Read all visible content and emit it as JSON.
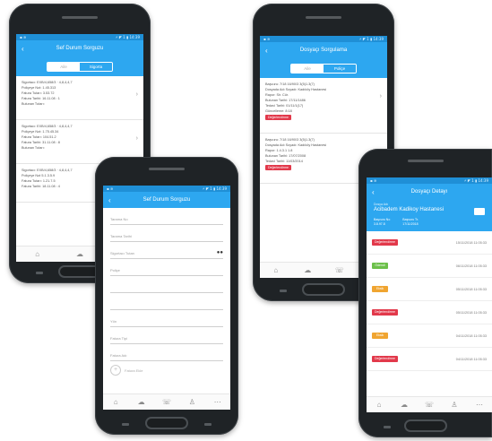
{
  "colors": {
    "primary": "#2da7f0",
    "status_dark": "#1f8fd6",
    "red": "#e2394b",
    "green": "#6cc04a",
    "orange": "#f0a531"
  },
  "phone1": {
    "status_left": "▪ ≋",
    "status_right": "⚡ ◤ 1 ▮ 14:39",
    "title": "Sef Durum Sorguzu",
    "tabs": [
      "Aile",
      "Sigorta"
    ],
    "cards": [
      {
        "lines": [
          "Sigortacı: EXB/4,658/3 · 4,8,4,4,7",
          "Poliçeye Not: 1.45.313",
          "Fatura Tutarı: 3.53.72",
          "Fatura Tarihi: 16.11.08 : 1",
          "Bulunan Tutarı:"
        ]
      },
      {
        "lines": [
          "Sigortacı: EXB/4,658/3 · 4,8,4,4,7",
          "Poliçeye Not: 1.75.45.34",
          "Fatura Tutarı: 104.51.2",
          "Fatura Tarihi: 31.11.08 : 8",
          "Bulunan Tutarı:"
        ]
      },
      {
        "lines": [
          "Sigortacı: EXB/4,658/3 · 4,8,4,4,7",
          "Poliçeye Not 5.1.3.5.9",
          "Fatura Tutarı: 1.21.7.5",
          "Fatura Tarihi: 18.11.08 : 4"
        ]
      }
    ],
    "tabbar": [
      "⌂",
      "☁",
      "☏"
    ]
  },
  "phone2": {
    "status_left": "▪ ≋",
    "status_right": "⚡ ◤ 1 ▮ 14:39",
    "title": "Sef Durum Sorguzu",
    "fields": [
      "Tarama No",
      "Tarama Tarihi",
      "Sigortacı Tutarı",
      "Poliçe",
      "",
      "",
      "Yön",
      "Fatura Tipi",
      "Fatura Adı"
    ],
    "eye": "●●",
    "fab_label": "Fatura Ekle",
    "tabbar": [
      "⌂",
      "☁",
      "☏",
      "♙",
      "⋯"
    ]
  },
  "phone3": {
    "status_left": "▪ ≋",
    "status_right": "⚡ ◤ 1 ▮ 14:39",
    "title": "Dosyaçı Sorgulama",
    "tabs": [
      "Aile",
      "Poliçe"
    ],
    "cards": [
      {
        "lines": [
          "Başvuru: 7/18 16/90/3 3(5)1.3(7)",
          "Dosyada Adı Soyadı: Kadıköy Hastanesi",
          "Rapor: Sir. Cür.",
          "Bulunan Tarihi: 17/11/1486",
          "Tedavi Tarihi: 01/11/1(17)",
          "Güncelleme: 8:18"
        ],
        "badge": "Değerlendirme"
      },
      {
        "lines": [
          "Başvuru: 7/18 16/90/3 3(5)1.3(7)",
          "Dosyada Adı Soyadı: Kadıköy Hastanesi",
          "Rapor: 1.4.3.1 1.8",
          "Bulunan Tarihi: 17/07/2008",
          "Tedavi Tarihi: 11/03/2014"
        ],
        "badge": "Değerlendirme"
      }
    ],
    "tabbar": [
      "⌂",
      "☁",
      "☏",
      "♙"
    ]
  },
  "phone4": {
    "status_left": "▪ ≋",
    "status_right": "⚡ ◤ 1 ▮ 14:39",
    "title": "Dosyaçı Detayı",
    "head_label": "Dosya Adı",
    "head_name": "Acibadem Kadikoy Hastanesi",
    "meta": [
      {
        "k": "Başvuru No",
        "v": "3.8.97.8"
      },
      {
        "k": "Başvuru Tr.",
        "v": "17/11/2018"
      }
    ],
    "rows": [
      {
        "label": "Değerlendirme",
        "color": "#e2394b",
        "date": "15/11/2018 11:05:33"
      },
      {
        "label": "Ödendi",
        "color": "#6cc04a",
        "date": "06/11/2018 11:05:33"
      },
      {
        "label": "Eksik",
        "color": "#f0a531",
        "date": "05/11/2018 11:05:33"
      },
      {
        "label": "Değerlendirme",
        "color": "#e2394b",
        "date": "05/11/2018 11:05:33"
      },
      {
        "label": "Eksik",
        "color": "#f0a531",
        "date": "04/11/2018 11:05:33"
      },
      {
        "label": "Değerlendirme",
        "color": "#e2394b",
        "date": "04/11/2018 11:05:33"
      }
    ],
    "tabbar": [
      "⌂",
      "☁",
      "☏",
      "♙",
      "⋯"
    ]
  }
}
